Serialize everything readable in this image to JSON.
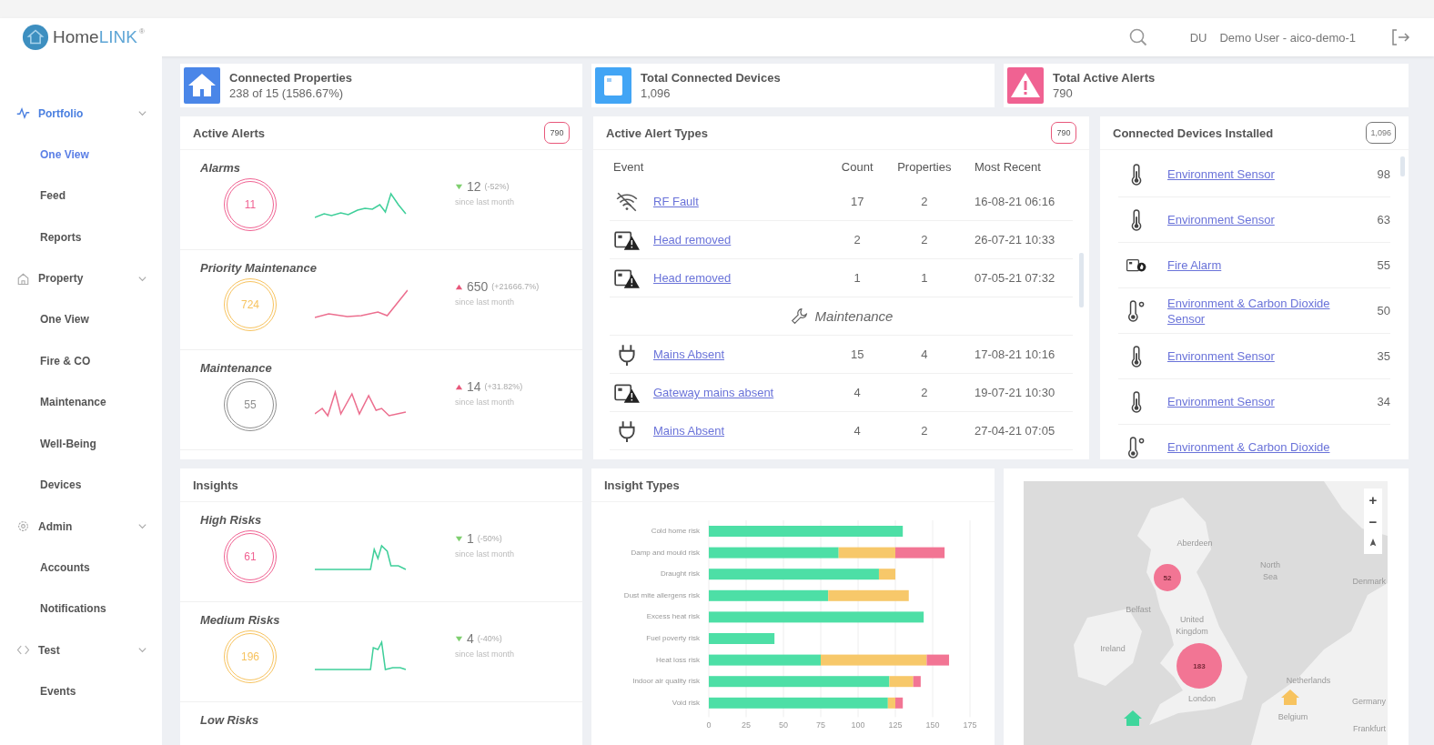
{
  "header": {
    "logo": {
      "part_1": "Home",
      "part_2": "LINK",
      "mark": "®"
    },
    "user": {
      "initials": "DU",
      "name": "Demo User - aico-demo-1"
    }
  },
  "sidebar": {
    "groups": [
      {
        "kind": "pulse",
        "label": "Portfolio",
        "selected": true,
        "expanded": true,
        "children": [
          {
            "label": "One View",
            "selected": true
          },
          {
            "label": "Feed",
            "selected": false
          },
          {
            "label": "Reports",
            "selected": false
          }
        ]
      },
      {
        "kind": "house",
        "label": "Property",
        "selected": false,
        "expanded": true,
        "children": [
          {
            "label": "One View",
            "selected": false
          },
          {
            "label": "Fire & CO",
            "selected": false
          },
          {
            "label": "Maintenance",
            "selected": false
          },
          {
            "label": "Well-Being",
            "selected": false
          },
          {
            "label": "Devices",
            "selected": false
          }
        ]
      },
      {
        "kind": "gear",
        "label": "Admin",
        "selected": false,
        "expanded": true,
        "children": [
          {
            "label": "Accounts",
            "selected": false
          },
          {
            "label": "Notifications",
            "selected": false
          }
        ]
      },
      {
        "kind": "code",
        "label": "Test",
        "selected": false,
        "expanded": true,
        "children": [
          {
            "label": "Events",
            "selected": false
          }
        ]
      }
    ]
  },
  "stats": [
    {
      "kind": "home",
      "color": "#4a86e8",
      "title": "Connected Properties",
      "value": "238 of 15 (1586.67%)"
    },
    {
      "kind": "device",
      "color": "#42a5f5",
      "title": "Total Connected Devices",
      "value": "1,096"
    },
    {
      "kind": "alert",
      "color": "#f06292",
      "title": "Total Active Alerts",
      "value": "790"
    }
  ],
  "active_alerts": {
    "title": "Active Alerts",
    "badge": "790",
    "metrics": [
      {
        "title": "Alarms",
        "value": "11",
        "color": "#f06292",
        "up": false,
        "change": "12",
        "percent": "(-52%)",
        "note": "since last month"
      },
      {
        "title": "Priority Maintenance",
        "value": "724",
        "color": "#f7c35f",
        "up": true,
        "change": "650",
        "percent": "(+21666.7%)",
        "note": "since last month"
      },
      {
        "title": "Maintenance",
        "value": "55",
        "color": "#8f8f8f",
        "up": true,
        "change": "14",
        "percent": "(+31.82%)",
        "note": "since last month"
      }
    ]
  },
  "alert_types": {
    "title": "Active Alert Types",
    "badge": "790",
    "columns": [
      "Event",
      "Count",
      "Properties",
      "Most Recent"
    ],
    "rows": [
      {
        "kind": "wifi-off",
        "event": "RF Fault",
        "count": "17",
        "properties": "2",
        "most_recent": "16-08-21 06:16"
      },
      {
        "kind": "sensor-alert",
        "event": "Head removed",
        "count": "2",
        "properties": "2",
        "most_recent": "26-07-21 10:33"
      },
      {
        "kind": "sensor-alert",
        "event": "Head removed",
        "count": "1",
        "properties": "1",
        "most_recent": "07-05-21 07:32"
      },
      {
        "kind": "section",
        "label": "Maintenance"
      },
      {
        "kind": "plug",
        "event": "Mains Absent",
        "count": "15",
        "properties": "4",
        "most_recent": "17-08-21 10:16"
      },
      {
        "kind": "sensor-alert",
        "event": "Gateway mains absent",
        "count": "4",
        "properties": "2",
        "most_recent": "19-07-21 10:30"
      },
      {
        "kind": "plug",
        "event": "Mains Absent",
        "count": "4",
        "properties": "2",
        "most_recent": "27-04-21 07:05"
      }
    ]
  },
  "devices": {
    "title": "Connected Devices Installed",
    "badge": "1,096",
    "rows": [
      {
        "kind": "thermometer",
        "name": "Environment Sensor",
        "count": "98"
      },
      {
        "kind": "thermometer",
        "name": "Environment Sensor",
        "count": "63"
      },
      {
        "kind": "fire-alarm",
        "name": "Fire Alarm",
        "count": "55"
      },
      {
        "kind": "thermometer-degree",
        "name": "Environment & Carbon Dioxide Sensor",
        "count": "50"
      },
      {
        "kind": "thermometer",
        "name": "Environment Sensor",
        "count": "35"
      },
      {
        "kind": "thermometer",
        "name": "Environment Sensor",
        "count": "34"
      },
      {
        "kind": "thermometer-degree",
        "name": "Environment & Carbon Dioxide"
      }
    ]
  },
  "insights": {
    "title": "Insights",
    "metrics": [
      {
        "title": "High Risks",
        "value": "61",
        "color": "#f06292",
        "up": false,
        "change": "1",
        "percent": "(-50%)",
        "note": "since last month"
      },
      {
        "title": "Medium Risks",
        "value": "196",
        "color": "#f7c35f",
        "up": false,
        "change": "4",
        "percent": "(-40%)",
        "note": "since last month"
      },
      {
        "title": "Low Risks"
      }
    ]
  },
  "insight_types": {
    "title": "Insight Types",
    "chart_data": {
      "type": "bar",
      "orientation": "horizontal",
      "stacked": true,
      "grid": true,
      "categories": [
        "Cold home risk",
        "Damp and mould risk",
        "Draught risk",
        "Dust mite allergens risk",
        "Excess heat risk",
        "Fuel poverty risk",
        "Heat loss risk",
        "Indoor air quality risk",
        "Void risk"
      ],
      "series": [
        {
          "color": "#4ddfa6",
          "values": [
            130,
            87,
            114,
            80,
            144,
            44,
            75,
            121,
            120
          ]
        },
        {
          "color": "#f7c86a",
          "values": [
            0,
            38,
            11,
            54,
            0,
            0,
            71,
            16,
            5
          ]
        },
        {
          "color": "#f27594",
          "values": [
            0,
            33,
            0,
            0,
            0,
            0,
            15,
            5,
            5
          ]
        }
      ],
      "xlim": [
        0,
        175
      ],
      "xticks": [
        0,
        25,
        50,
        75,
        100,
        125,
        150,
        175
      ]
    }
  },
  "map": {
    "labels": [
      "Aberdeen",
      "North",
      "Sea",
      "Denmark",
      "Belfast",
      "United",
      "Kingdom",
      "Ireland",
      "Netherlands",
      "Germany",
      "Belgium",
      "London",
      "Frankfurt"
    ],
    "clusters": [
      {
        "count": "52",
        "color": "#f27594"
      },
      {
        "count": "183",
        "color": "#f27594"
      }
    ],
    "markers": [
      {
        "color": "#3fd69c"
      },
      {
        "color": "#f7c35f"
      }
    ],
    "controls": [
      "+",
      "−"
    ]
  }
}
